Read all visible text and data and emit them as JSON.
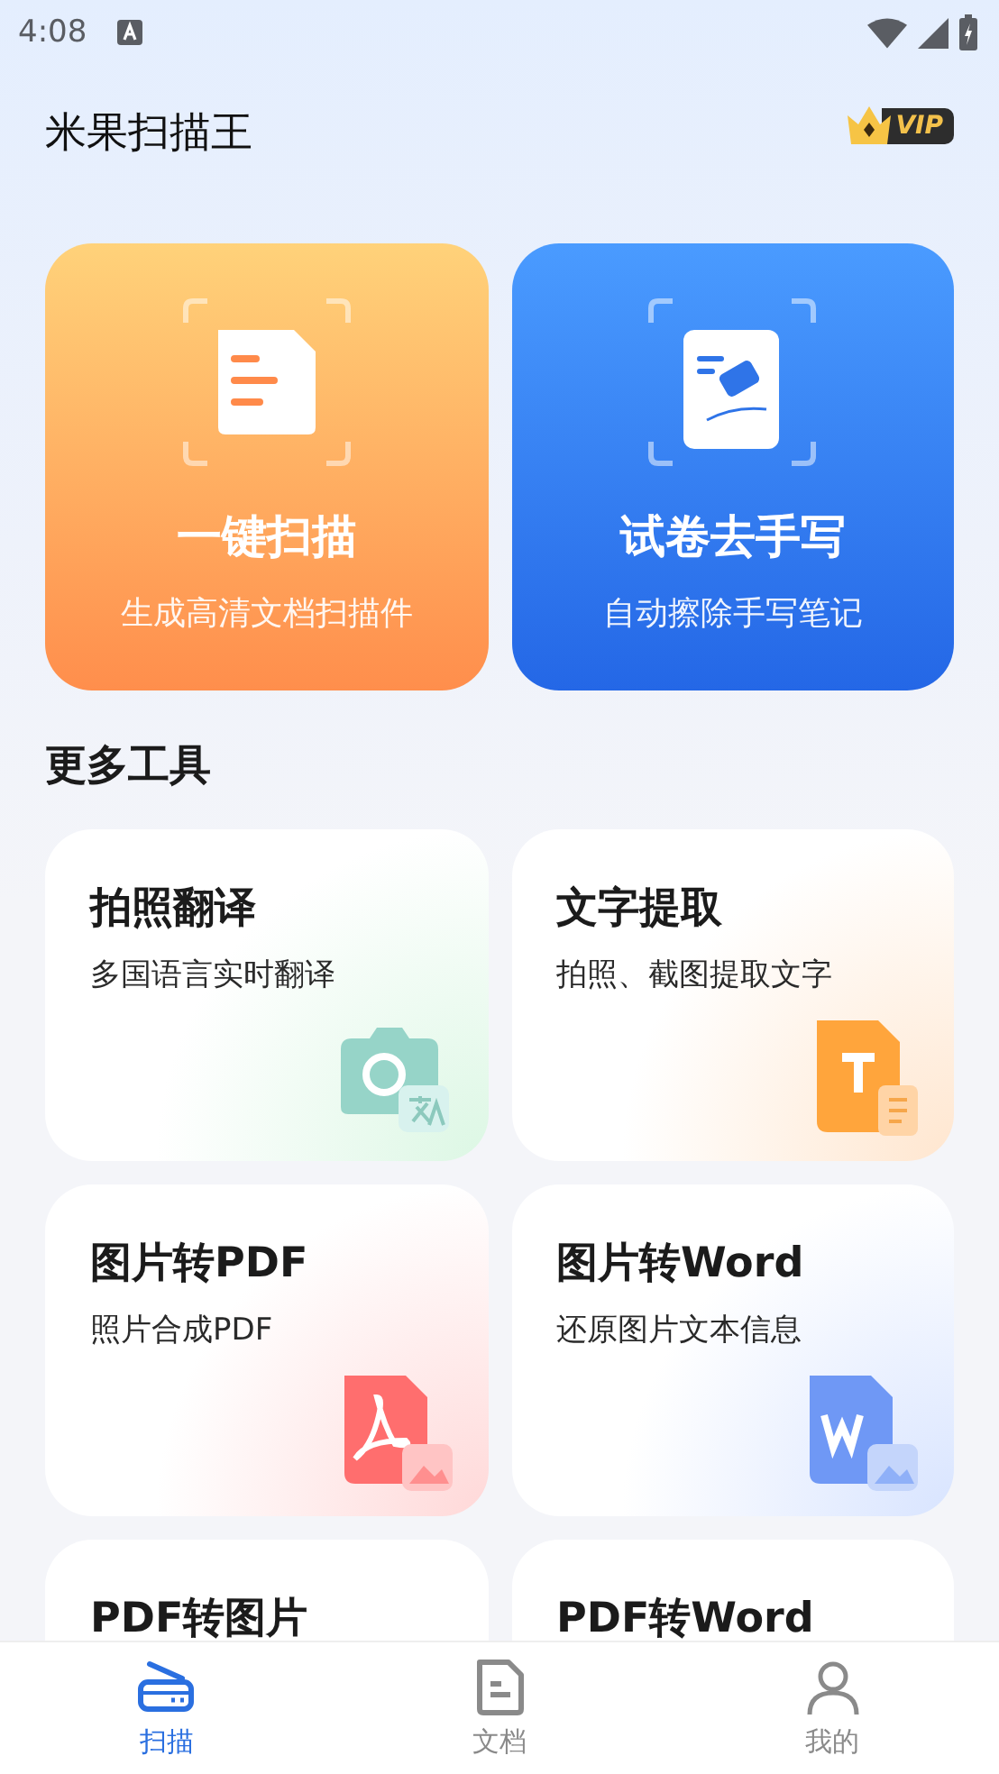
{
  "status_bar": {
    "time": "4:08"
  },
  "header": {
    "title": "米果扫描王",
    "vip_badge": "VIP"
  },
  "feature_cards": [
    {
      "kind": "scan",
      "title": "一键扫描",
      "subtitle": "生成高清文档扫描件"
    },
    {
      "kind": "erase",
      "title": "试卷去手写",
      "subtitle": "自动擦除手写笔记"
    }
  ],
  "section_title": "更多工具",
  "tools": [
    {
      "kind": "translate",
      "title": "拍照翻译",
      "subtitle": "多国语言实时翻译"
    },
    {
      "kind": "text",
      "title": "文字提取",
      "subtitle": "拍照、截图提取文字"
    },
    {
      "kind": "pdf",
      "title": "图片转PDF",
      "subtitle": "照片合成PDF"
    },
    {
      "kind": "word",
      "title": "图片转Word",
      "subtitle": "还原图片文本信息"
    },
    {
      "kind": "plain",
      "title": "PDF转图片"
    },
    {
      "kind": "plain",
      "title": "PDF转Word"
    }
  ],
  "bottom_nav": [
    {
      "kind": "scan",
      "label": "扫描",
      "selected": true
    },
    {
      "kind": "docs",
      "label": "文档",
      "selected": false
    },
    {
      "kind": "me",
      "label": "我的",
      "selected": false
    }
  ]
}
